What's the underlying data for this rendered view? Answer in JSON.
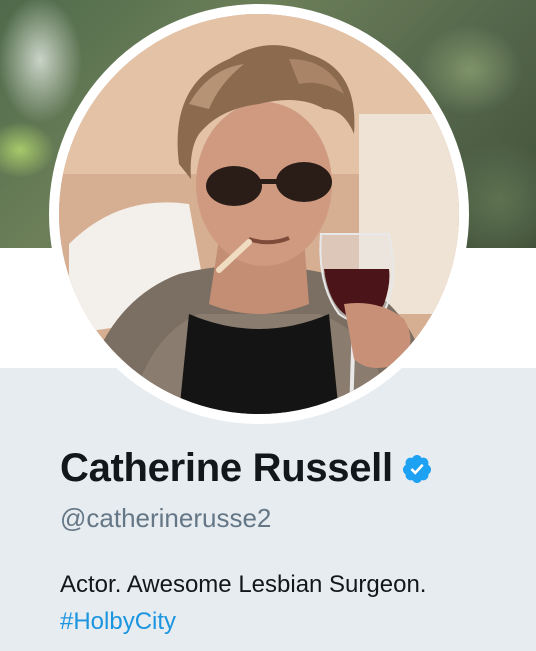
{
  "profile": {
    "display_name": "Catherine Russell",
    "verified": true,
    "handle": "@catherinerusse2",
    "bio_text": "Actor. Awesome Lesbian Surgeon.",
    "bio_hashtag": "#HolbyCity"
  },
  "icons": {
    "verified": "verified-badge-icon"
  },
  "colors": {
    "name": "#14171a",
    "handle": "#657786",
    "link": "#1b95e0",
    "verified": "#1da1f2",
    "background": "#e6ecf0"
  }
}
